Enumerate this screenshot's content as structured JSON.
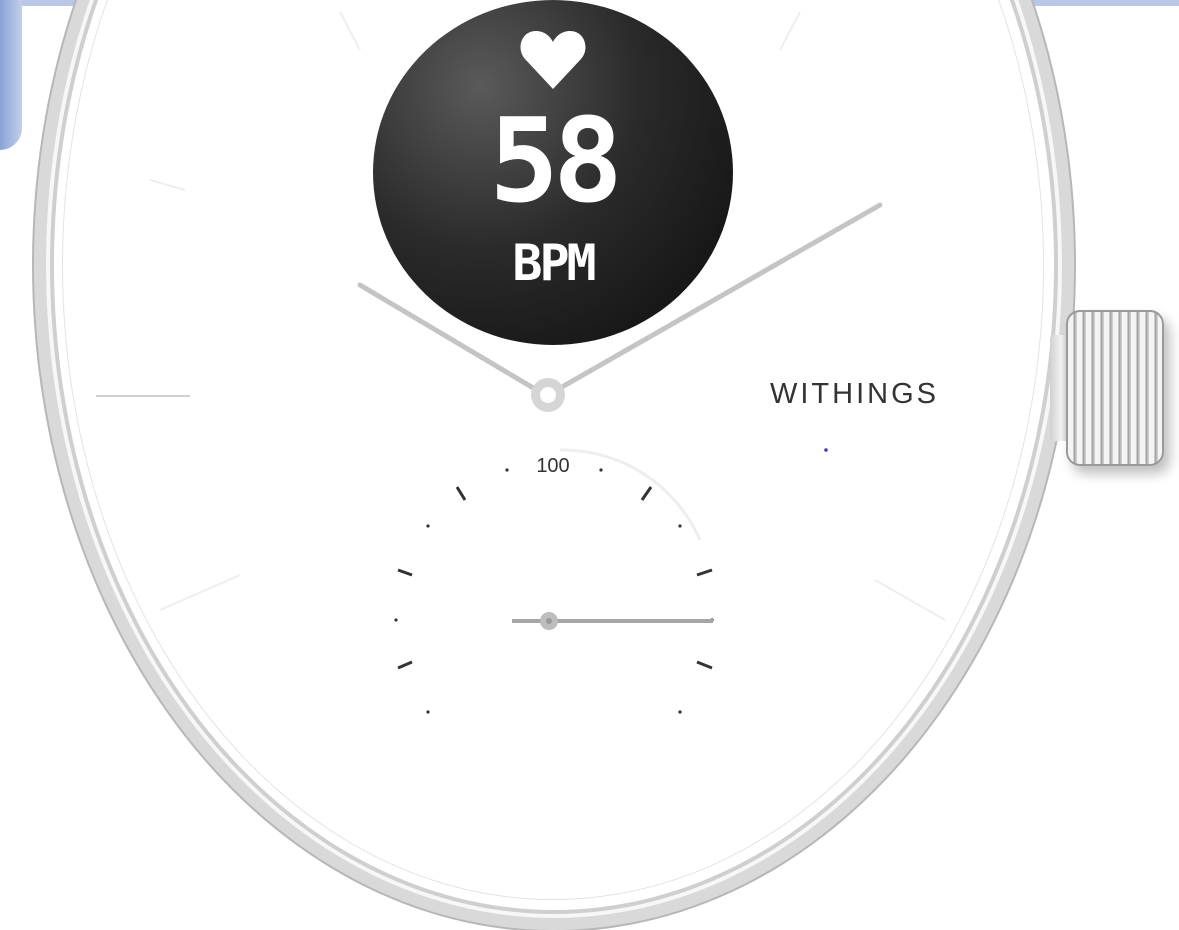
{
  "display": {
    "icon": "heart-icon",
    "value": "58",
    "unit": "BPM"
  },
  "brand": {
    "name": "WITHINGS"
  },
  "subdial": {
    "label": "100"
  },
  "colors": {
    "display_background": "#1a1a1a",
    "display_text": "#ffffff",
    "dial": "#ffffff",
    "case": "#d9d9d9",
    "accent_dot": "#3b3bd6"
  }
}
